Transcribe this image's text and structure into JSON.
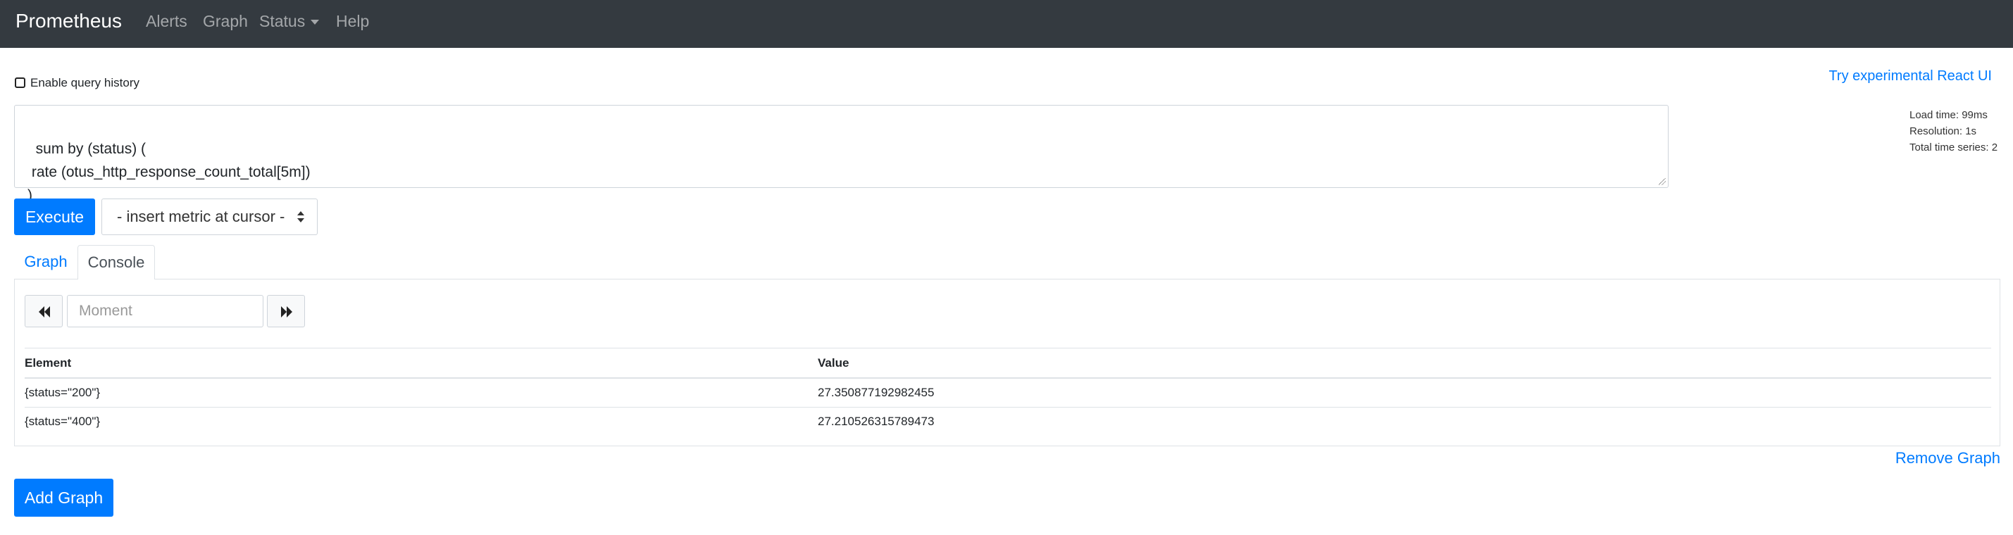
{
  "navbar": {
    "brand": "Prometheus",
    "items": [
      {
        "label": "Alerts"
      },
      {
        "label": "Graph"
      },
      {
        "label": "Status"
      },
      {
        "label": "Help"
      }
    ]
  },
  "query_history": {
    "label": "Enable query history",
    "checked": false
  },
  "react_link": "Try experimental React UI",
  "stats": {
    "load_time": "Load time: 99ms",
    "resolution": "Resolution: 1s",
    "total_series": "Total time series: 2"
  },
  "query": {
    "expression": "sum by (status) (\n rate (otus_http_response_count_total[5m])\n)"
  },
  "execute_label": "Execute",
  "metric_select": {
    "selected": "- insert metric at cursor -"
  },
  "tabs": [
    {
      "label": "Graph",
      "active": false
    },
    {
      "label": "Console",
      "active": true
    }
  ],
  "console": {
    "moment_placeholder": "Moment",
    "columns": [
      "Element",
      "Value"
    ],
    "rows": [
      {
        "element": "{status=\"200\"}",
        "value": "27.350877192982455"
      },
      {
        "element": "{status=\"400\"}",
        "value": "27.210526315789473"
      }
    ]
  },
  "remove_graph": "Remove Graph",
  "add_graph": "Add Graph",
  "colors": {
    "navbar": "#343a40",
    "primary": "#007bff",
    "border": "#dee2e6"
  }
}
